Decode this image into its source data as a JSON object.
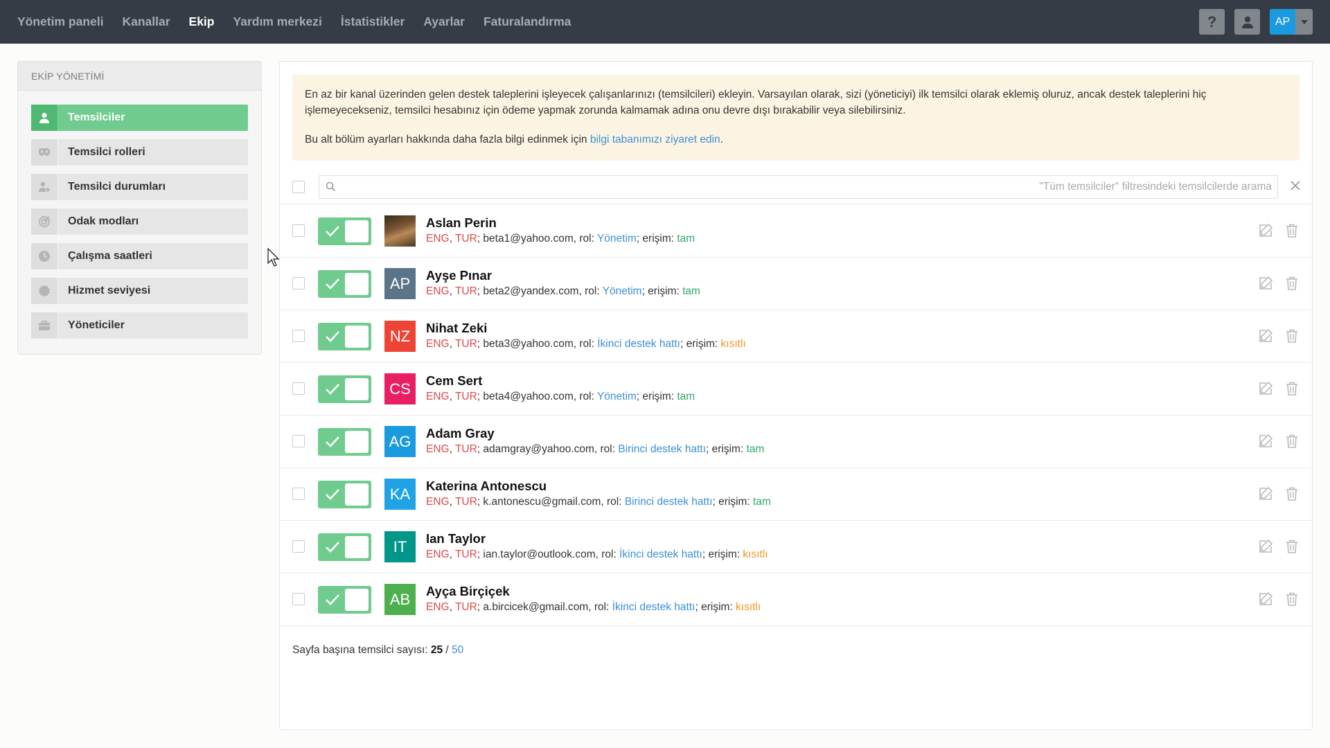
{
  "nav": {
    "items": [
      {
        "label": "Yönetim paneli",
        "name": "nav-dashboard",
        "active": false
      },
      {
        "label": "Kanallar",
        "name": "nav-channels",
        "active": false
      },
      {
        "label": "Ekip",
        "name": "nav-team",
        "active": true
      },
      {
        "label": "Yardım merkezi",
        "name": "nav-help-center",
        "active": false
      },
      {
        "label": "İstatistikler",
        "name": "nav-statistics",
        "active": false
      },
      {
        "label": "Ayarlar",
        "name": "nav-settings",
        "active": false
      },
      {
        "label": "Faturalandırma",
        "name": "nav-billing",
        "active": false
      }
    ],
    "help_label": "?",
    "user_initials": "AP"
  },
  "sidebar": {
    "header": "EKİP YÖNETİMİ",
    "items": [
      {
        "label": "Temsilciler",
        "icon": "user-icon",
        "active": true
      },
      {
        "label": "Temsilci rolleri",
        "icon": "mask-icon",
        "active": false
      },
      {
        "label": "Temsilci durumları",
        "icon": "user-status-icon",
        "active": false
      },
      {
        "label": "Odak modları",
        "icon": "target-icon",
        "active": false
      },
      {
        "label": "Çalışma saatleri",
        "icon": "clock-icon",
        "active": false
      },
      {
        "label": "Hizmet seviyesi",
        "icon": "badge-icon",
        "active": false
      },
      {
        "label": "Yöneticiler",
        "icon": "briefcase-icon",
        "active": false
      }
    ]
  },
  "info": {
    "paragraph1": "En az bir kanal üzerinden gelen destek taleplerini işleyecek çalışanlarınızı (temsilcileri) ekleyin. Varsayılan olarak, sizi (yöneticiyi) ilk temsilci olarak eklemiş oluruz, ancak destek taleplerini hiç işlemeyecekseniz, temsilci hesabınız için ödeme yapmak zorunda kalmamak adına onu devre dışı bırakabilir veya silebilirsiniz.",
    "paragraph2_prefix": "Bu alt bölüm ayarları hakkında daha fazla bilgi edinmek için ",
    "paragraph2_link": "bilgi tabanımızı ziyaret edin",
    "paragraph2_suffix": "."
  },
  "search": {
    "value": "",
    "placeholder": "\"Tüm temsilciler\" filtresindeki temsilcilerde arama"
  },
  "agents": [
    {
      "name": "Aslan Perin",
      "initials": "",
      "avatar_color": "",
      "photo": true,
      "lang1": "ENG",
      "lang2": "TUR",
      "email": "beta1@yahoo.com",
      "role": "Yönetim",
      "access": "tam",
      "access_type": "full"
    },
    {
      "name": "Ayşe Pınar",
      "initials": "AP",
      "avatar_color": "#5b7489",
      "photo": false,
      "lang1": "ENG",
      "lang2": "TUR",
      "email": "beta2@yandex.com",
      "role": "Yönetim",
      "access": "tam",
      "access_type": "full"
    },
    {
      "name": "Nihat Zeki",
      "initials": "NZ",
      "avatar_color": "#ee4436",
      "photo": false,
      "lang1": "ENG",
      "lang2": "TUR",
      "email": "beta3@yahoo.com",
      "role": "İkinci destek hattı",
      "access": "kısıtlı",
      "access_type": "limited"
    },
    {
      "name": "Cem Sert",
      "initials": "CS",
      "avatar_color": "#e91e63",
      "photo": false,
      "lang1": "ENG",
      "lang2": "TUR",
      "email": "beta4@yahoo.com",
      "role": "Yönetim",
      "access": "tam",
      "access_type": "full"
    },
    {
      "name": "Adam Gray",
      "initials": "AG",
      "avatar_color": "#1a9be0",
      "photo": false,
      "lang1": "ENG",
      "lang2": "TUR",
      "email": "adamgray@yahoo.com",
      "role": "Birinci destek hattı",
      "access": "tam",
      "access_type": "full"
    },
    {
      "name": "Katerina Antonescu",
      "initials": "KA",
      "avatar_color": "#1fa3e6",
      "photo": false,
      "lang1": "ENG",
      "lang2": "TUR",
      "email": "k.antonescu@gmail.com",
      "role": "Birinci destek hattı",
      "access": "tam",
      "access_type": "full"
    },
    {
      "name": "Ian Taylor",
      "initials": "IT",
      "avatar_color": "#00968a",
      "photo": false,
      "lang1": "ENG",
      "lang2": "TUR",
      "email": "ian.taylor@outlook.com",
      "role": "İkinci destek hattı",
      "access": "kısıtlı",
      "access_type": "limited"
    },
    {
      "name": "Ayça Birçiçek",
      "initials": "AB",
      "avatar_color": "#4db04f",
      "photo": false,
      "lang1": "ENG",
      "lang2": "TUR",
      "email": "a.bircicek@gmail.com",
      "role": "İkinci destek hattı",
      "access": "kısıtlı",
      "access_type": "limited"
    }
  ],
  "row_labels": {
    "role_prefix": ", rol: ",
    "access_prefix": "; erişim: ",
    "sep": ", ",
    "semicolon": "; "
  },
  "pager": {
    "label": "Sayfa başına temsilci sayısı: ",
    "current": "25",
    "divider": " / ",
    "option": "50"
  },
  "colors": {
    "accent_green": "#6fcb8e",
    "nav_bg": "#363c45",
    "link": "#3b8fd6",
    "full": "#2ea866",
    "limited": "#f0951f",
    "lang": "#e04848"
  }
}
